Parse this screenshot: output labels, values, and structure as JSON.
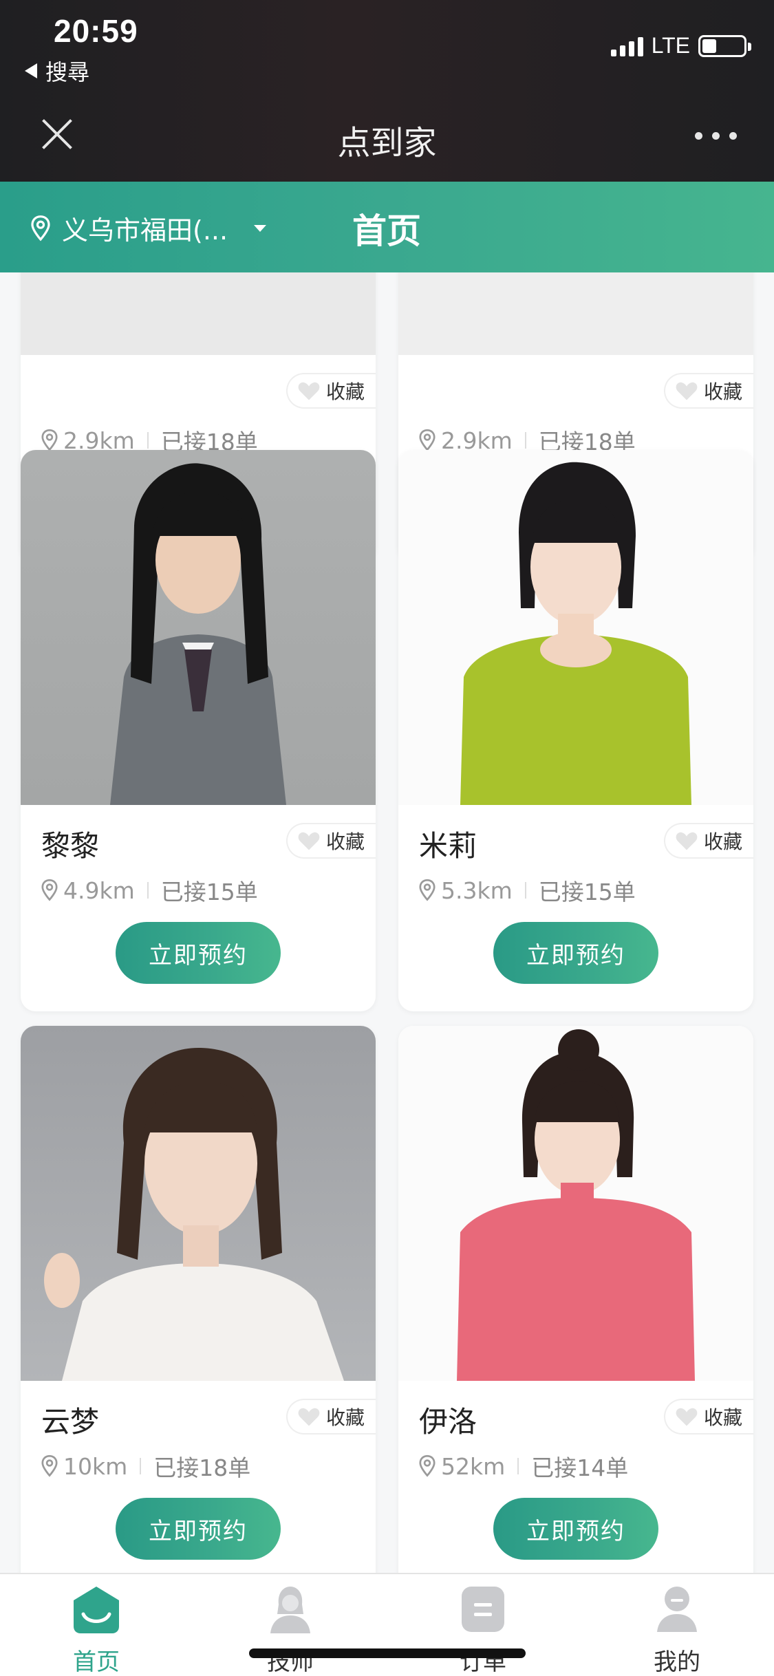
{
  "status_bar": {
    "time": "20:59",
    "back_app": "搜尋",
    "network": "LTE"
  },
  "nav_bar": {
    "title": "点到家"
  },
  "header": {
    "location": "义乌市福田(...",
    "title": "首页"
  },
  "card_action": {
    "favorite_label": "收藏",
    "book_label": "立即预约"
  },
  "cards": [
    {
      "name": "",
      "distance": "2.9km",
      "orders": "已接18单"
    },
    {
      "name": "",
      "distance": "2.9km",
      "orders": "已接18单"
    },
    {
      "name": "黎黎",
      "distance": "4.9km",
      "orders": "已接15单"
    },
    {
      "name": "米莉",
      "distance": "5.3km",
      "orders": "已接15单"
    },
    {
      "name": "云梦",
      "distance": "10km",
      "orders": "已接18单"
    },
    {
      "name": "伊洛",
      "distance": "52km",
      "orders": "已接14单"
    }
  ],
  "tabbar": {
    "items": [
      {
        "label": "首页",
        "active": true
      },
      {
        "label": "技师",
        "active": false
      },
      {
        "label": "订单",
        "active": false
      },
      {
        "label": "我的",
        "active": false
      }
    ]
  },
  "colors": {
    "accent": "#2fa48c",
    "header_start": "#2a9e8a",
    "header_end": "#46b58f"
  }
}
